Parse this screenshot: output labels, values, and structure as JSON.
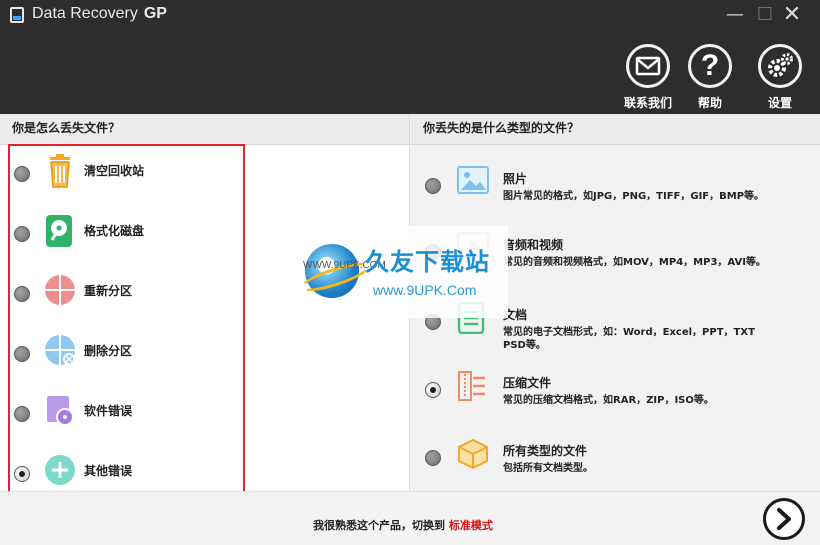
{
  "app": {
    "title": "Data Recovery",
    "title_suffix": "GP"
  },
  "window_controls": {
    "minimize": "—",
    "maximize": "☐",
    "close": "✕"
  },
  "toolbar": {
    "contact_label": "联系我们",
    "help_label": "帮助",
    "settings_label": "设置"
  },
  "left": {
    "heading": "你是怎么丢失文件？",
    "items": [
      {
        "label": "清空回收站",
        "icon": "recycle-bin-icon",
        "selected": false
      },
      {
        "label": "格式化磁盘",
        "icon": "format-disk-icon",
        "selected": false
      },
      {
        "label": "重新分区",
        "icon": "repartition-icon",
        "selected": false
      },
      {
        "label": "删除分区",
        "icon": "delete-partition-icon",
        "selected": false
      },
      {
        "label": "软件错误",
        "icon": "software-error-icon",
        "selected": false
      },
      {
        "label": "其他错误",
        "icon": "other-error-icon",
        "selected": true
      }
    ]
  },
  "right": {
    "heading": "你丢失的是什么类型的文件？",
    "types": [
      {
        "title": "照片",
        "desc": "图片常见的格式，如JPG，PNG，TIFF，GIF，BMP等。",
        "icon": "photo-icon",
        "selected": false
      },
      {
        "title": "音频和视频",
        "desc": "常见的音频和视频格式，如MOV，MP4，MP3，AVI等。",
        "icon": "media-icon",
        "selected": false
      },
      {
        "title": "文档",
        "desc": "常见的电子文档形式，如：Word，Excel，PPT，TXT PSD等。",
        "icon": "document-icon",
        "selected": false
      },
      {
        "title": "压缩文件",
        "desc": "常见的压缩文档格式，如RAR，ZIP，ISO等。",
        "icon": "archive-icon",
        "selected": true
      },
      {
        "title": "所有类型的文件",
        "desc": "包括所有文档类型。",
        "icon": "all-files-icon",
        "selected": false
      }
    ]
  },
  "watermark": {
    "title": "久友下载站",
    "left_text": "WWW.9UPK.COM",
    "url": "www.9UPK.Com"
  },
  "footer": {
    "text": "我很熟悉这个产品，切换到",
    "mode_link": "标准模式"
  },
  "colors": {
    "header_bg": "#2d2d2d",
    "highlight_box": "#e3232b",
    "link_red": "#d01818"
  }
}
